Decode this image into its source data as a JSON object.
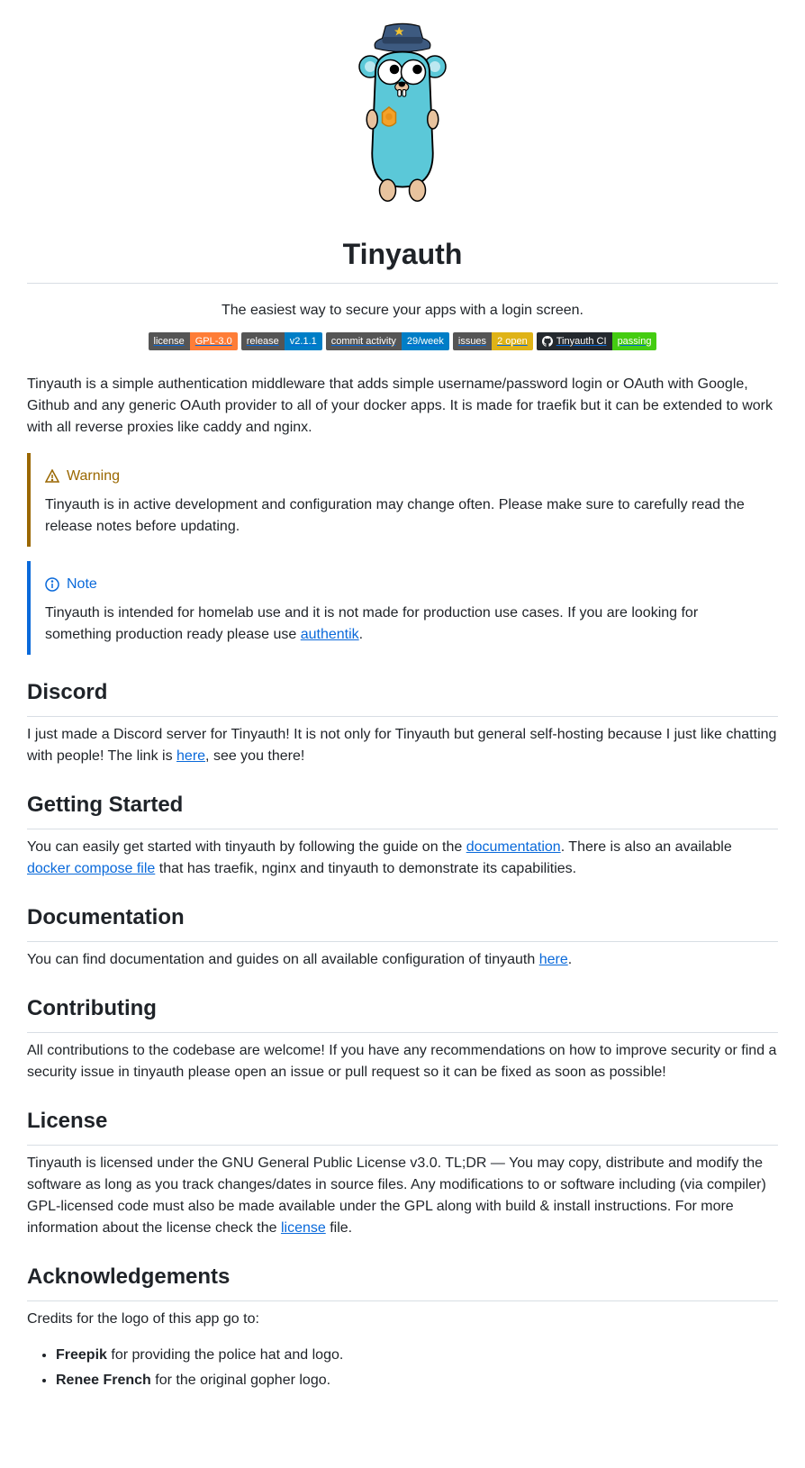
{
  "title": "Tinyauth",
  "tagline": "The easiest way to secure your apps with a login screen.",
  "badges": [
    {
      "left": "license",
      "right": "GPL-3.0",
      "rightClass": "br-orange"
    },
    {
      "left": "release",
      "right": "v2.1.1",
      "rightClass": "br-blue"
    },
    {
      "left": "commit activity",
      "right": "29/week",
      "rightClass": "br-blue"
    },
    {
      "left": "issues",
      "right": "2 open",
      "rightClass": "br-yellow"
    },
    {
      "left": "Tinyauth CI",
      "right": "passing",
      "rightClass": "br-green",
      "github": true
    }
  ],
  "intro": "Tinyauth is a simple authentication middleware that adds simple username/password login or OAuth with Google, Github and any generic OAuth provider to all of your docker apps. It is made for traefik but it can be extended to work with all reverse proxies like caddy and nginx.",
  "warning": {
    "title": "Warning",
    "body": "Tinyauth is in active development and configuration may change often. Please make sure to carefully read the release notes before updating."
  },
  "note": {
    "title": "Note",
    "body_before": "Tinyauth is intended for homelab use and it is not made for production use cases. If you are looking for something production ready please use ",
    "link": "authentik",
    "body_after": "."
  },
  "discord": {
    "heading": "Discord",
    "text_before": "I just made a Discord server for Tinyauth! It is not only for Tinyauth but general self-hosting because I just like chatting with people! The link is ",
    "link": "here",
    "text_after": ", see you there!"
  },
  "getting_started": {
    "heading": "Getting Started",
    "t1": "You can easily get started with tinyauth by following the guide on the ",
    "link1": "documentation",
    "t2": ". There is also an available ",
    "link2": "docker compose file",
    "t3": " that has traefik, nginx and tinyauth to demonstrate its capabilities."
  },
  "documentation": {
    "heading": "Documentation",
    "t1": "You can find documentation and guides on all available configuration of tinyauth ",
    "link": "here",
    "t2": "."
  },
  "contributing": {
    "heading": "Contributing",
    "body": "All contributions to the codebase are welcome! If you have any recommendations on how to improve security or find a security issue in tinyauth please open an issue or pull request so it can be fixed as soon as possible!"
  },
  "license": {
    "heading": "License",
    "t1": "Tinyauth is licensed under the GNU General Public License v3.0. TL;DR — You may copy, distribute and modify the software as long as you track changes/dates in source files. Any modifications to or software including (via compiler) GPL-licensed code must also be made available under the GPL along with build & install instructions. For more information about the license check the ",
    "link": "license",
    "t2": " file."
  },
  "ack": {
    "heading": "Acknowledgements",
    "intro": "Credits for the logo of this app go to:",
    "item1_bold": "Freepik",
    "item1_rest": " for providing the police hat and logo.",
    "item2_bold": "Renee French",
    "item2_rest": " for the original gopher logo."
  }
}
